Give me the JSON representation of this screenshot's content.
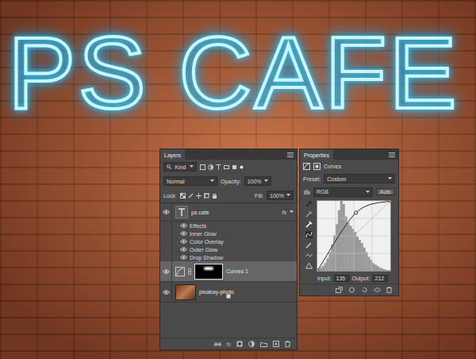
{
  "canvas": {
    "text": "PS CAFE"
  },
  "layers_panel": {
    "title": "Layers",
    "filter": "Kind",
    "blend_mode": "Normal",
    "opacity_label": "Opacity:",
    "opacity": "100%",
    "lock_label": "Lock:",
    "fill_label": "Fill:",
    "fill": "100%",
    "footer_fx": "fx",
    "layers": [
      {
        "name": "ps cafe",
        "kind": "text",
        "visible": true,
        "selected": false,
        "fx": "fx",
        "effects_label": "Effects",
        "effects": [
          {
            "name": "Inner Glow",
            "visible": true
          },
          {
            "name": "Color Overlay",
            "visible": true
          },
          {
            "name": "Outer Glow",
            "visible": true
          },
          {
            "name": "Drop Shadow",
            "visible": true
          }
        ]
      },
      {
        "name": "Curves 1",
        "kind": "adjustment",
        "visible": true,
        "selected": true
      },
      {
        "name": "pixabay-photo",
        "kind": "photo",
        "visible": true,
        "selected": false
      }
    ]
  },
  "properties_panel": {
    "title": "Properties",
    "adjustment": "Curves",
    "preset_label": "Preset:",
    "preset": "Custom",
    "channel": "RGB",
    "auto_button": "Auto",
    "curve_points": [
      [
        0,
        0
      ],
      [
        135,
        212
      ],
      [
        255,
        255
      ]
    ],
    "histogram": [
      2,
      4,
      6,
      10,
      16,
      24,
      34,
      46,
      60,
      78,
      90,
      86,
      70,
      62,
      58,
      54,
      50,
      44,
      40,
      36,
      30,
      24,
      18,
      14,
      10,
      8,
      6,
      4,
      3,
      2,
      1,
      1
    ],
    "input_label": "Input:",
    "input": "135",
    "output_label": "Output:",
    "output": "212"
  }
}
